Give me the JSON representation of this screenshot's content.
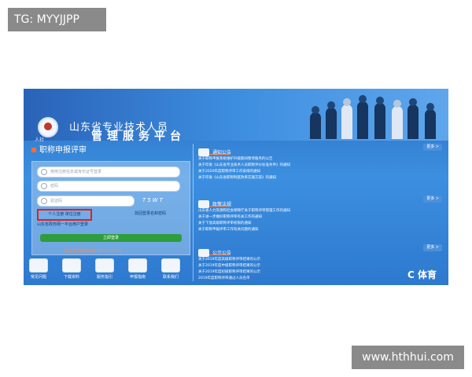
{
  "overlays": {
    "tag_text": "TG: MYYJJPP",
    "watermark_text": "www.hthhui.com"
  },
  "header": {
    "emblem_caption": "人社",
    "title_line1": "山东省专业技术人员",
    "title_line2": "管理服务平台"
  },
  "login": {
    "section_title": "职称申报评审",
    "username_placeholder": "使用注册信息或身份证号登录",
    "password_placeholder": "密码",
    "captcha_placeholder": "验证码",
    "captcha_text": "T5WT",
    "personal_register_link": "个人注册  单位注册",
    "forgot_link": "找回登录名和密码",
    "support_link": "山东省政务网一平台用户登录",
    "login_button": "立即登录",
    "footer_note": "系统运行服务热线 0531-12333"
  },
  "dock": [
    {
      "label": "常见问题",
      "icon": "faq-icon"
    },
    {
      "label": "下载资料",
      "icon": "download-icon"
    },
    {
      "label": "服务指引",
      "icon": "guide-icon"
    },
    {
      "label": "申报指南",
      "icon": "books-icon"
    },
    {
      "label": "联系我们",
      "icon": "phone-icon"
    }
  ],
  "sections": [
    {
      "name": "通知公告",
      "more": "更多 >",
      "items": [
        "关于职称申报系统维护升级期间暂停服务的公告",
        "关于印发《山东省专业技术人员职称评价标准条件》的通知",
        "关于2020年度职称评审工作安排的通知",
        "关于印发《山东省职称制度改革实施方案》的通知"
      ]
    },
    {
      "name": "政策法规",
      "more": "更多 >",
      "items": [
        "山东省人力资源和社会保障厅关于职称评审管理工作的通知",
        "关于进一步做好职称评审有关工作的通知",
        "关于下放高级职称评审权限的通知",
        "关于职称申报评审工作有关问题的通知"
      ]
    },
    {
      "name": "公示公告",
      "more": "更多 >",
      "items": [
        "关于2019年度高级职称评审结果的公示",
        "关于2019年度中级职称评审结果的公示",
        "关于2019年度初级职称评审结果的公示",
        "2019年度职称评审通过人员名单"
      ]
    }
  ],
  "brand_mark": "C 体育"
}
